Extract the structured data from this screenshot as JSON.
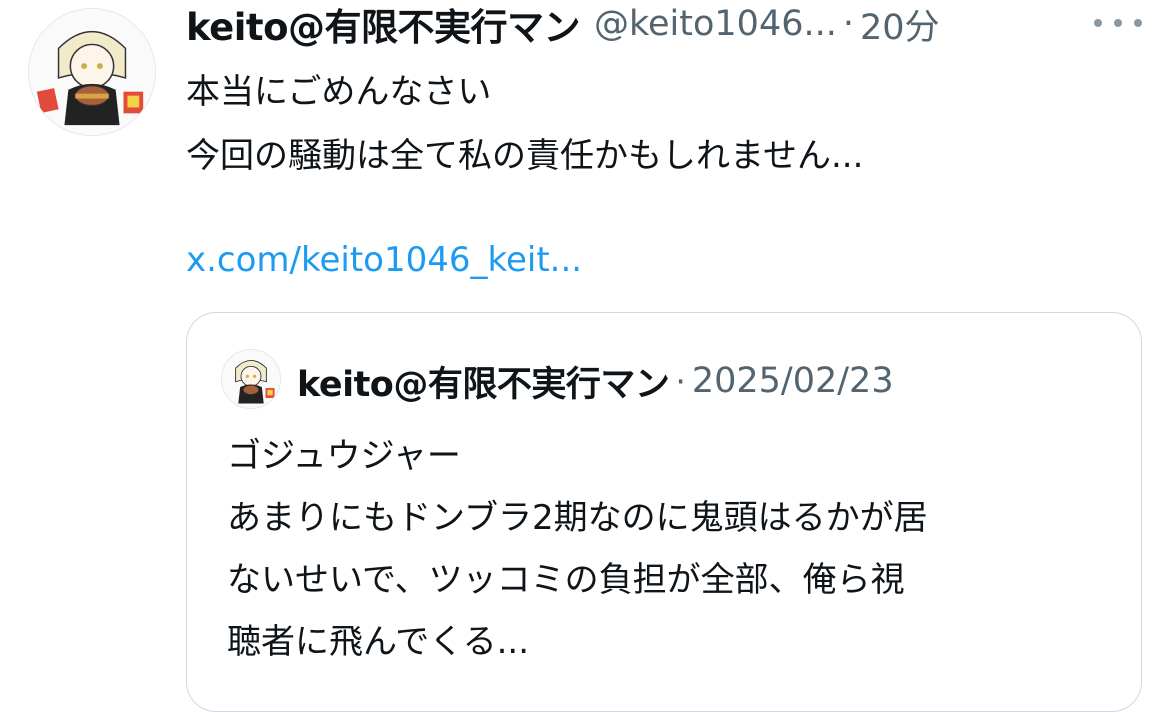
{
  "tweet": {
    "author_name": "keito@有限不実行マン",
    "author_handle": "@keito1046...",
    "separator": "·",
    "time": "20分",
    "more_icon": "more-horizontal-icon",
    "lines": [
      "本当にごめんなさい",
      "今回の騒動は全て私の責任かもしれません..."
    ],
    "link_text": "x.com/keito1046_keit...",
    "link_color": "#1d9bf0"
  },
  "quote": {
    "author_name": "keito@有限不実行マン",
    "separator": "·",
    "date": "2025/02/23",
    "lines": [
      "ゴジュウジャー",
      "あまりにもドンブラ2期なのに鬼頭はるかが居",
      "ないせいで、ツッコミの負担が全部、俺ら視",
      "聴者に飛んでくる..."
    ]
  },
  "colors": {
    "text": "#0f1419",
    "secondary": "#536471",
    "border": "#cfd9de",
    "background": "#ffffff"
  }
}
